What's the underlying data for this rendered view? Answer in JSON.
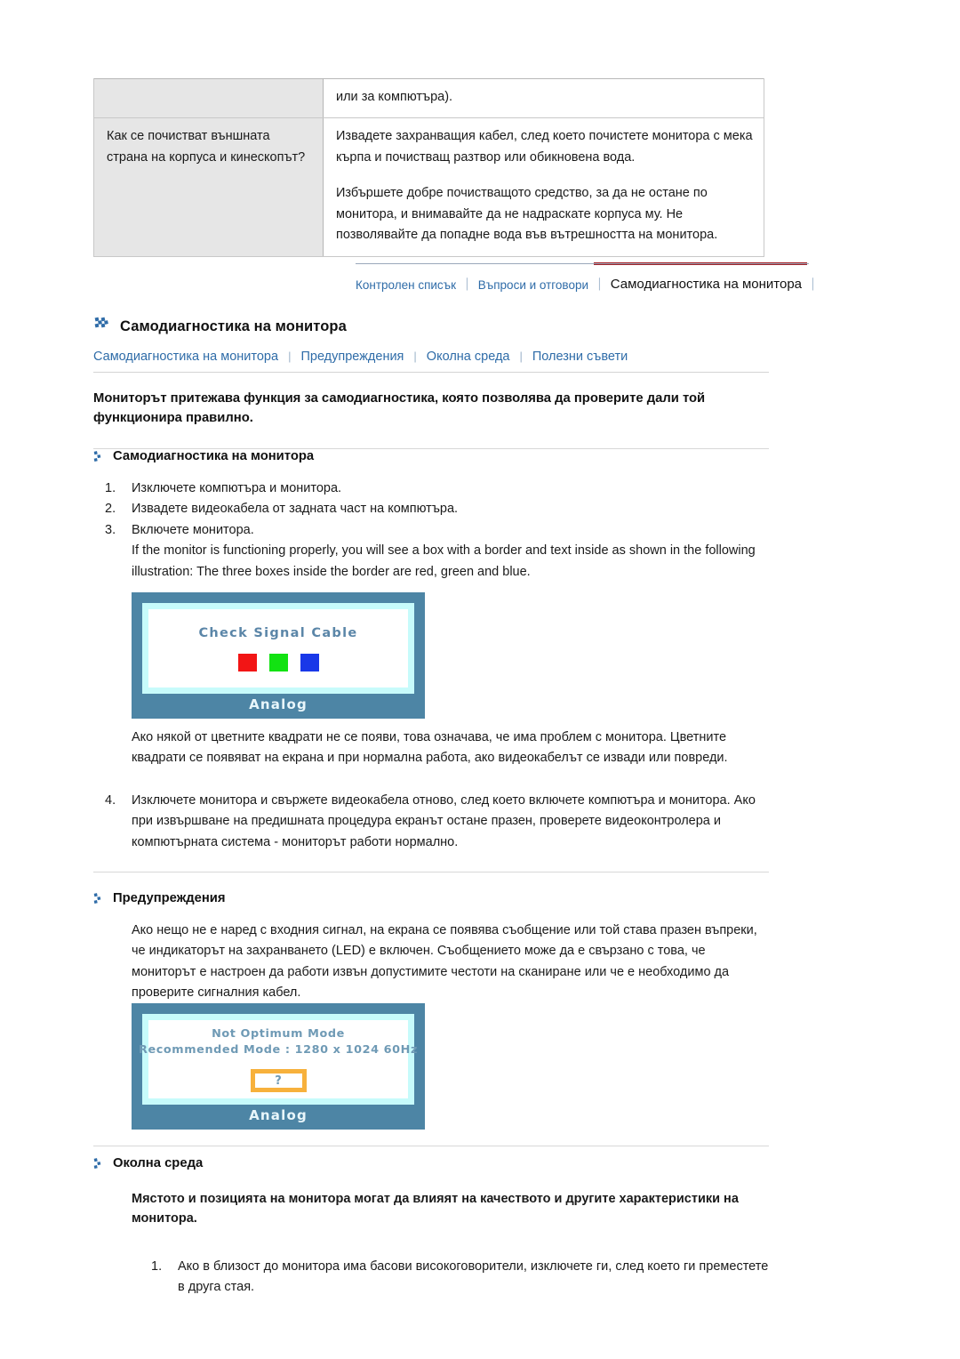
{
  "faq_table": {
    "rows": [
      {
        "question": "",
        "answer_parts": [
          "или за компютъра)."
        ]
      },
      {
        "question": "Как се почистват външната страна на корпуса и кинескопът?",
        "answer_parts": [
          "Извадете захранващия кабел, след което почистете монитора с мека кърпа и почистващ разтвор или обикновена вода.",
          "Избършете добре почистващото средство, за да не остане по монитора, и внимавайте да не надраскате корпуса му. Не позволявайте да попадне вода във вътрешността на монитора."
        ]
      }
    ]
  },
  "tabbar": {
    "tabs": [
      {
        "label": "Контролен списък",
        "active": false
      },
      {
        "label": "Въпроси и отговори",
        "active": false
      },
      {
        "label": "Самодиагностика на монитора",
        "active": true
      }
    ],
    "separator": "׀"
  },
  "page_title": "Самодиагностика на монитора",
  "subnav": {
    "items": [
      "Самодиагностика на монитора",
      "Предупреждения",
      "Околна среда",
      "Полезни съвети"
    ],
    "separator": "|"
  },
  "intro": "Мониторът притежава функция за самодиагностика, която позволява да проверите дали той функционира правилно.",
  "section_selftest": {
    "heading": "Самодиагностика на монитора",
    "steps": [
      {
        "num": "1.",
        "text": "Изключете компютъра и монитора."
      },
      {
        "num": "2.",
        "text": "Извадете видеокабела от задната част на компютъра."
      },
      {
        "num": "3.",
        "text": "Включете монитора."
      }
    ],
    "step3_extra": "If the monitor is functioning properly, you will see a box with a border and text inside as shown in the following illustration: The three boxes inside the border are red, green and blue.",
    "after_illustration": "Ако някой от цветните квадрати не се появи, това означава, че има проблем с монитора. Цветните квадрати се появяват на екрана и при нормална работа, ако видеокабелът се извади или повреди.",
    "step4": {
      "num": "4.",
      "text": "Изключете монитора и свържете видеокабела отново, след което включете компютъра и монитора. Ако при извършване на предишната процедура екранът остане празен, проверете видеоконтролера и компютърната система - мониторът работи нормално."
    }
  },
  "illustration_1": {
    "message": "Check Signal Cable",
    "label": "Analog",
    "colors": [
      "#f21515",
      "#12e212",
      "#1938e8"
    ],
    "frame_color": "#4d85a5",
    "inner_border_color": "#c7fbfb"
  },
  "section_warnings": {
    "heading": "Предупреждения",
    "paragraph": "Ако нещо не е наред с входния сигнал, на екрана се появява съобщение или той става празен въпреки, че индикаторът на захранването (LED) е включен. Съобщението може да е свързано с това, че мониторът е настроен да работи извън допустимите честоти на сканиране или че е необходимо да проверите сигналния кабел."
  },
  "illustration_2": {
    "line1": "Not Optimum Mode",
    "line2": "Recommended Mode : 1280 x 1024  60Hz",
    "question_mark": "?",
    "label": "Analog",
    "frame_color": "#4d85a5",
    "qbox_border_color": "#f7b13c"
  },
  "section_environment": {
    "heading": "Околна среда",
    "bold_paragraph": "Мястото и позицията на монитора могат да влияят на качеството и другите характеристики на монитора.",
    "steps": [
      {
        "num": "1.",
        "text": "Ако в близост до монитора има басови високоговорители, изключете ги, след което ги преместете в друга стая."
      }
    ]
  }
}
